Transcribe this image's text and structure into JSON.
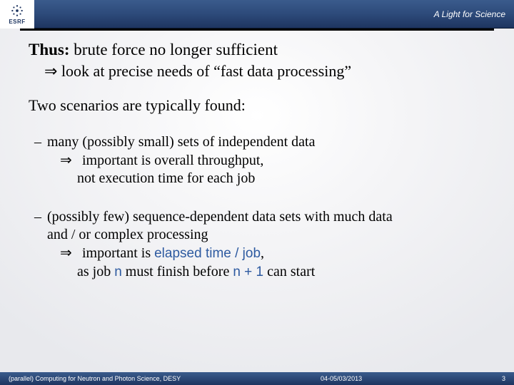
{
  "header": {
    "logo_text": "ESRF",
    "tagline": "A Light for Science"
  },
  "title": {
    "lead": "Thus:",
    "rest": " brute force no longer sufficient"
  },
  "subline": {
    "arrow": "⇒",
    "text": " look at precise needs of “fast data processing”"
  },
  "section": "Two scenarios are typically found:",
  "bullets": [
    {
      "line1": "many (possibly small) sets of independent data",
      "arrow": "⇒",
      "line2a": "  important is overall throughput,",
      "line2b": "not execution time for each job"
    },
    {
      "line1": "(possibly few) sequence-dependent data sets with much data",
      "line1b": "and / or complex processing",
      "arrow": "⇒",
      "line2_pre": "  important is ",
      "hl1": "elapsed time / job",
      "line2_post": ",",
      "line3_pre": "as job ",
      "hl2": "n",
      "line3_mid": " must finish before ",
      "hl3": "n + 1",
      "line3_post": " can start"
    }
  ],
  "footer": {
    "left": "(parallel)  Computing for Neutron and Photon Science, DESY",
    "center": "04-05/03/2013",
    "right": "3"
  }
}
